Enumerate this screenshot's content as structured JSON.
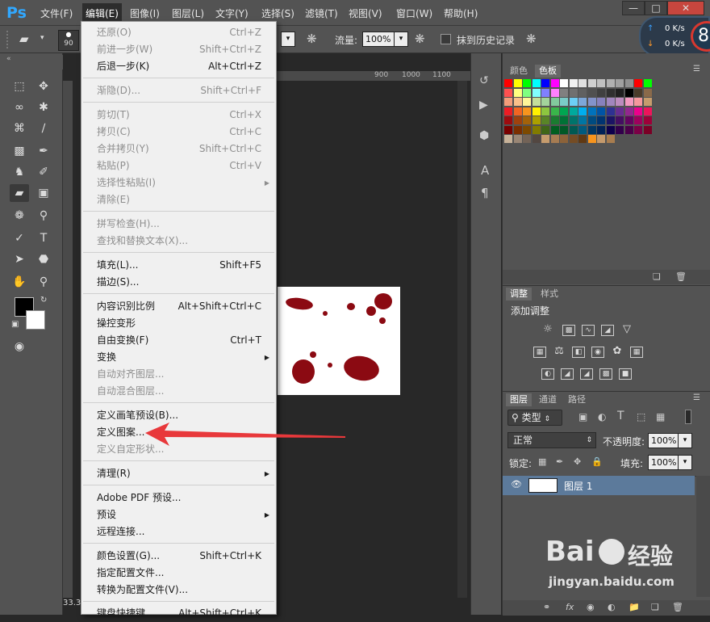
{
  "app": {
    "logo": "Ps"
  },
  "menubar": {
    "items": [
      "文件(F)",
      "编辑(E)",
      "图像(I)",
      "图层(L)",
      "文字(Y)",
      "选择(S)",
      "滤镜(T)",
      "视图(V)",
      "窗口(W)",
      "帮助(H)"
    ]
  },
  "window": {
    "minimize": "—",
    "maximize": "□",
    "close": "✕"
  },
  "options": {
    "brush_size": "90",
    "mode_arrow": "▾",
    "flow_label": "流量:",
    "flow_value": "100%",
    "erase_history": "抹到历史记录"
  },
  "network": {
    "up": "0 K/s",
    "down": "0 K/s",
    "badge": "8"
  },
  "document": {
    "tab_partial": "未",
    "ruler_ticks": [
      "900",
      "1000",
      "1100"
    ],
    "zoom": "33.3"
  },
  "edit_menu": {
    "items": [
      {
        "label": "还原(O)",
        "shortcut": "Ctrl+Z",
        "disabled": true
      },
      {
        "label": "前进一步(W)",
        "shortcut": "Shift+Ctrl+Z",
        "disabled": true
      },
      {
        "label": "后退一步(K)",
        "shortcut": "Alt+Ctrl+Z",
        "disabled": false
      },
      {
        "label": "渐隐(D)...",
        "shortcut": "Shift+Ctrl+F",
        "disabled": true
      },
      {
        "label": "剪切(T)",
        "shortcut": "Ctrl+X",
        "disabled": true
      },
      {
        "label": "拷贝(C)",
        "shortcut": "Ctrl+C",
        "disabled": true
      },
      {
        "label": "合并拷贝(Y)",
        "shortcut": "Shift+Ctrl+C",
        "disabled": true
      },
      {
        "label": "粘贴(P)",
        "shortcut": "Ctrl+V",
        "disabled": true
      },
      {
        "label": "选择性粘贴(I)",
        "shortcut": "",
        "disabled": true,
        "submenu": true
      },
      {
        "label": "清除(E)",
        "shortcut": "",
        "disabled": true
      },
      {
        "label": "拼写检查(H)...",
        "shortcut": "",
        "disabled": true
      },
      {
        "label": "查找和替换文本(X)...",
        "shortcut": "",
        "disabled": true
      },
      {
        "label": "填充(L)...",
        "shortcut": "Shift+F5",
        "disabled": false
      },
      {
        "label": "描边(S)...",
        "shortcut": "",
        "disabled": false
      },
      {
        "label": "内容识别比例",
        "shortcut": "Alt+Shift+Ctrl+C",
        "disabled": false
      },
      {
        "label": "操控变形",
        "shortcut": "",
        "disabled": false
      },
      {
        "label": "自由变换(F)",
        "shortcut": "Ctrl+T",
        "disabled": false
      },
      {
        "label": "变换",
        "shortcut": "",
        "disabled": false,
        "submenu": true
      },
      {
        "label": "自动对齐图层...",
        "shortcut": "",
        "disabled": true
      },
      {
        "label": "自动混合图层...",
        "shortcut": "",
        "disabled": true
      },
      {
        "label": "定义画笔预设(B)...",
        "shortcut": "",
        "disabled": false
      },
      {
        "label": "定义图案...",
        "shortcut": "",
        "disabled": false
      },
      {
        "label": "定义自定形状...",
        "shortcut": "",
        "disabled": true
      },
      {
        "label": "清理(R)",
        "shortcut": "",
        "disabled": false,
        "submenu": true
      },
      {
        "label": "Adobe PDF 预设...",
        "shortcut": "",
        "disabled": false
      },
      {
        "label": "预设",
        "shortcut": "",
        "disabled": false,
        "submenu": true
      },
      {
        "label": "远程连接...",
        "shortcut": "",
        "disabled": false
      },
      {
        "label": "颜色设置(G)...",
        "shortcut": "Shift+Ctrl+K",
        "disabled": false
      },
      {
        "label": "指定配置文件...",
        "shortcut": "",
        "disabled": false
      },
      {
        "label": "转换为配置文件(V)...",
        "shortcut": "",
        "disabled": false
      },
      {
        "label": "键盘快捷键...",
        "shortcut": "Alt+Shift+Ctrl+K",
        "disabled": false
      }
    ]
  },
  "swatch_panel": {
    "tab_color": "颜色",
    "tab_swatches": "色板"
  },
  "adjust_panel": {
    "tab_adjust": "调整",
    "tab_styles": "样式",
    "title": "添加调整"
  },
  "layers_panel": {
    "tab_layers": "图层",
    "tab_channels": "通道",
    "tab_paths": "路径",
    "filter_kind": "类型",
    "blend_mode": "正常",
    "opacity_label": "不透明度:",
    "opacity_value": "100%",
    "lock_label": "锁定:",
    "fill_label": "填充:",
    "fill_value": "100%",
    "layer_name": "图层 1"
  },
  "watermark": {
    "brand": "Bai",
    "brand2": "经验",
    "url": "jingyan.baidu.com"
  },
  "colors": {
    "accent": "#31a8ff",
    "arrow": "#e8383b"
  }
}
